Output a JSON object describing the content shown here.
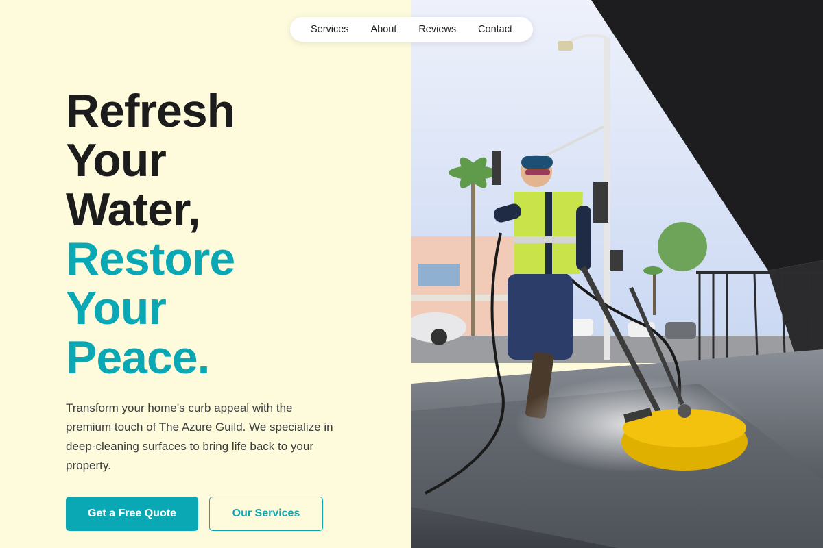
{
  "nav": {
    "items": [
      {
        "label": "Services"
      },
      {
        "label": "About"
      },
      {
        "label": "Reviews"
      },
      {
        "label": "Contact"
      }
    ]
  },
  "hero": {
    "headline_dark": [
      "Refresh",
      "Your",
      "Water,"
    ],
    "headline_teal": [
      "Restore",
      "Your",
      "Peace."
    ],
    "intro": "Transform your home's curb appeal with the premium touch of The Azure Guild. We specialize in deep-cleaning surfaces to bring life back to your property.",
    "primary_cta": "Get a Free Quote",
    "secondary_cta": "Our Services"
  },
  "colors": {
    "background": "#fdfbdc",
    "accent": "#0aa8b4",
    "text_dark": "#1c1c1c"
  }
}
